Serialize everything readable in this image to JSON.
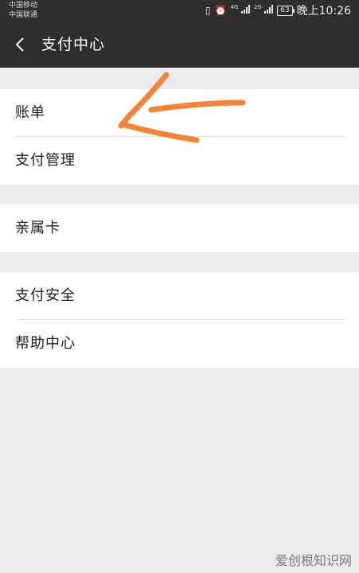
{
  "status_bar": {
    "carrier_1": "中国移动",
    "carrier_2": "中国联通",
    "net_1": "4G",
    "net_2": "2G",
    "battery": "63",
    "time": "晚上10:26"
  },
  "header": {
    "title": "支付中心",
    "back_icon": "back-arrow-icon"
  },
  "groups": [
    {
      "items": [
        {
          "label": "账单"
        },
        {
          "label": "支付管理"
        }
      ]
    },
    {
      "items": [
        {
          "label": "亲属卡"
        }
      ]
    },
    {
      "items": [
        {
          "label": "支付安全"
        },
        {
          "label": "帮助中心"
        }
      ]
    }
  ],
  "annotation": {
    "color": "#f0843a"
  },
  "watermark": "爱创根知识网"
}
